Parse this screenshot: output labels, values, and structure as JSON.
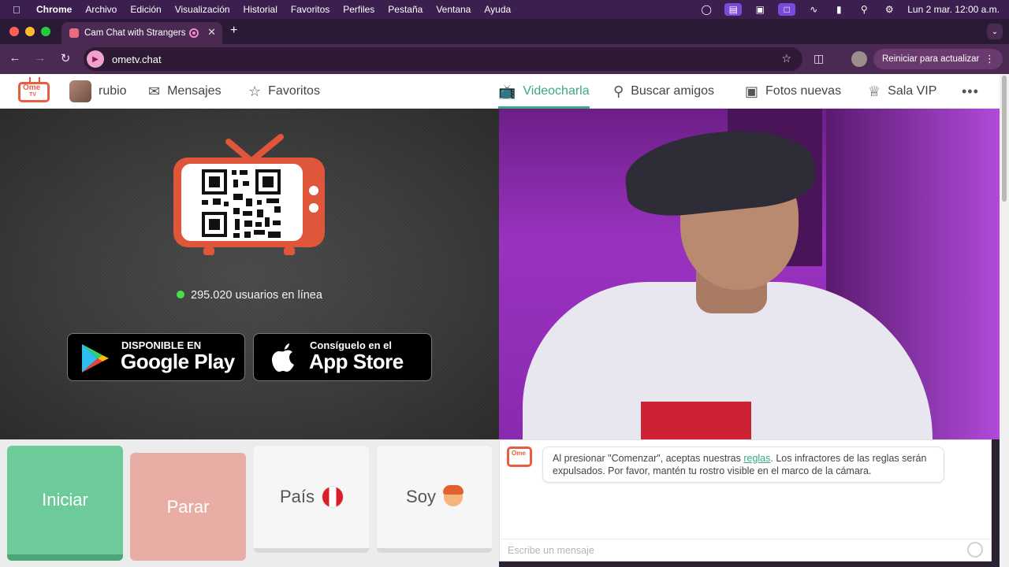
{
  "menubar": {
    "app": "Chrome",
    "items": [
      "Archivo",
      "Edición",
      "Visualización",
      "Historial",
      "Favoritos",
      "Perfiles",
      "Pestaña",
      "Ventana",
      "Ayuda"
    ],
    "datetime": "Lun 2 mar.  12:00 a.m."
  },
  "browser": {
    "tab_title": "Cam Chat with Strangers",
    "url": "ometv.chat",
    "update_button": "Reiniciar para actualizar"
  },
  "site_nav": {
    "logo_text": "Ome",
    "logo_sub": "TV",
    "username": "rubio",
    "messages": "Mensajes",
    "favorites": "Favoritos",
    "videochat": "Videocharla",
    "find_friends": "Buscar amigos",
    "new_photos": "Fotos nuevas",
    "vip": "Sala VIP",
    "more": "•••"
  },
  "promo": {
    "online_count": "295.020 usuarios en línea",
    "google_play_small": "DISPONIBLE EN",
    "google_play_big": "Google Play",
    "app_store_small": "Consíguelo en el",
    "app_store_big": "App Store"
  },
  "controls": {
    "start": "Iniciar",
    "stop": "Parar",
    "country": "País",
    "gender": "Soy"
  },
  "chat": {
    "msg_before": "Al presionar \"Comenzar\", aceptas nuestras ",
    "msg_link": "reglas",
    "msg_after": ". Los infractores de las reglas serán expulsados. Por favor, mantén tu rostro visible en el marco de la cámara.",
    "input_placeholder": "Escribe un mensaje"
  },
  "colors": {
    "accent": "#3aa882",
    "start": "#6ccb98",
    "stop": "#e8aea6",
    "brand": "#e85c3f",
    "online_dot": "#45e04c"
  }
}
